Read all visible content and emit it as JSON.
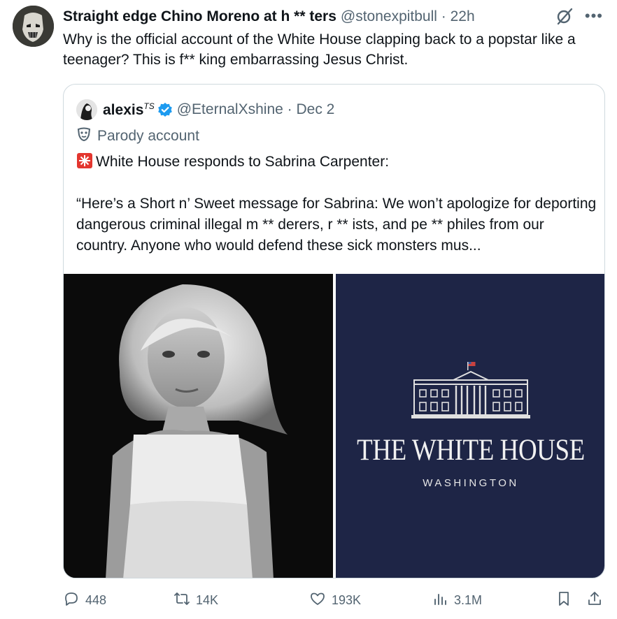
{
  "post": {
    "author_name": "Straight edge Chino Moreno at h ** ters",
    "author_handle": "@stonexpitbull",
    "separator": "·",
    "time": "22h",
    "text": "Why is the official account of the White House clapping back to a popstar like a teenager? This is f** king embarrassing Jesus Christ."
  },
  "quote": {
    "author_name": "alexis",
    "author_name_suffix": "TS",
    "author_handle": "@EternalXshine",
    "separator": "·",
    "time": "Dec 2",
    "parody_label": "Parody account",
    "line1": "White House responds to Sabrina Carpenter:",
    "line2": "“Here’s a Short n’ Sweet message for Sabrina: We won’t apologize for deporting dangerous criminal illegal m ** derers, r ** ists, and pe ** philes from our country. Anyone who would defend these sick monsters mus...",
    "media": {
      "left_image": "black and white portrait photo",
      "right_title": "THE WHITE HOUSE",
      "right_subtitle": "WASHINGTON"
    }
  },
  "actions": {
    "replies": "448",
    "reposts": "14K",
    "likes": "193K",
    "views": "3.1M"
  },
  "icons": {
    "grok": "grok-icon",
    "more": "more-icon",
    "reply": "reply-icon",
    "repost": "repost-icon",
    "like": "like-icon",
    "views": "views-icon",
    "bookmark": "bookmark-icon",
    "share": "share-icon",
    "verified": "verified-badge-icon",
    "parody": "parody-mask-icon",
    "siren": "siren-icon"
  },
  "colors": {
    "text": "#0f1419",
    "secondary": "#536471",
    "verified": "#1d9bf0",
    "border": "#cfd9de",
    "wh_navy": "#1e2546"
  }
}
